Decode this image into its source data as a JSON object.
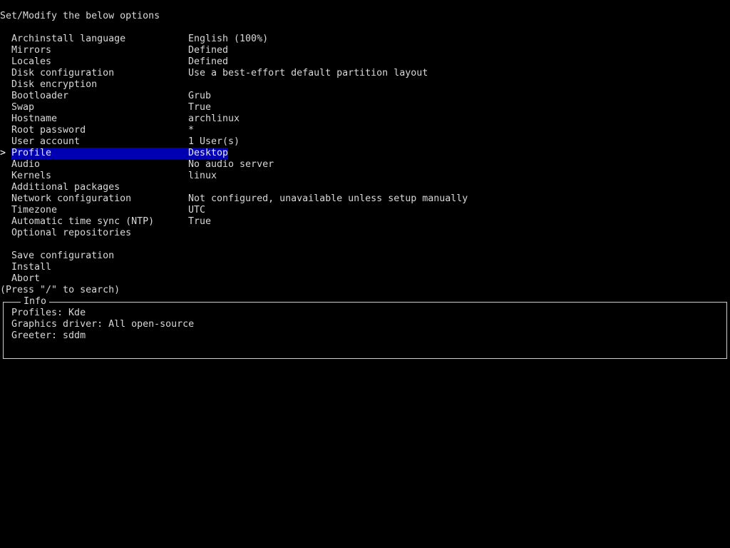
{
  "header": {
    "title": "Set/Modify the below options"
  },
  "menu": {
    "cursor_glyph": ">",
    "items": [
      {
        "label": "Archinstall language",
        "value": "English (100%)"
      },
      {
        "label": "Mirrors",
        "value": "Defined"
      },
      {
        "label": "Locales",
        "value": "Defined"
      },
      {
        "label": "Disk configuration",
        "value": "Use a best-effort default partition layout"
      },
      {
        "label": "Disk encryption",
        "value": ""
      },
      {
        "label": "Bootloader",
        "value": "Grub"
      },
      {
        "label": "Swap",
        "value": "True"
      },
      {
        "label": "Hostname",
        "value": "archlinux"
      },
      {
        "label": "Root password",
        "value": "*"
      },
      {
        "label": "User account",
        "value": "1 User(s)"
      },
      {
        "label": "Profile",
        "value": "Desktop",
        "selected": true
      },
      {
        "label": "Audio",
        "value": "No audio server"
      },
      {
        "label": "Kernels",
        "value": "linux"
      },
      {
        "label": "Additional packages",
        "value": ""
      },
      {
        "label": "Network configuration",
        "value": "Not configured, unavailable unless setup manually"
      },
      {
        "label": "Timezone",
        "value": "UTC"
      },
      {
        "label": "Automatic time sync (NTP)",
        "value": "True"
      },
      {
        "label": "Optional repositories",
        "value": ""
      }
    ],
    "actions": [
      {
        "label": "Save configuration"
      },
      {
        "label": "Install"
      },
      {
        "label": "Abort"
      }
    ],
    "search_hint": "(Press \"/\" to search)"
  },
  "info": {
    "title": "Info",
    "lines": [
      "Profiles: Kde",
      "Graphics driver: All open-source",
      "Greeter: sddm"
    ]
  },
  "colors": {
    "background": "#000000",
    "text": "#d8d8d8",
    "highlight": "#0000b2"
  }
}
